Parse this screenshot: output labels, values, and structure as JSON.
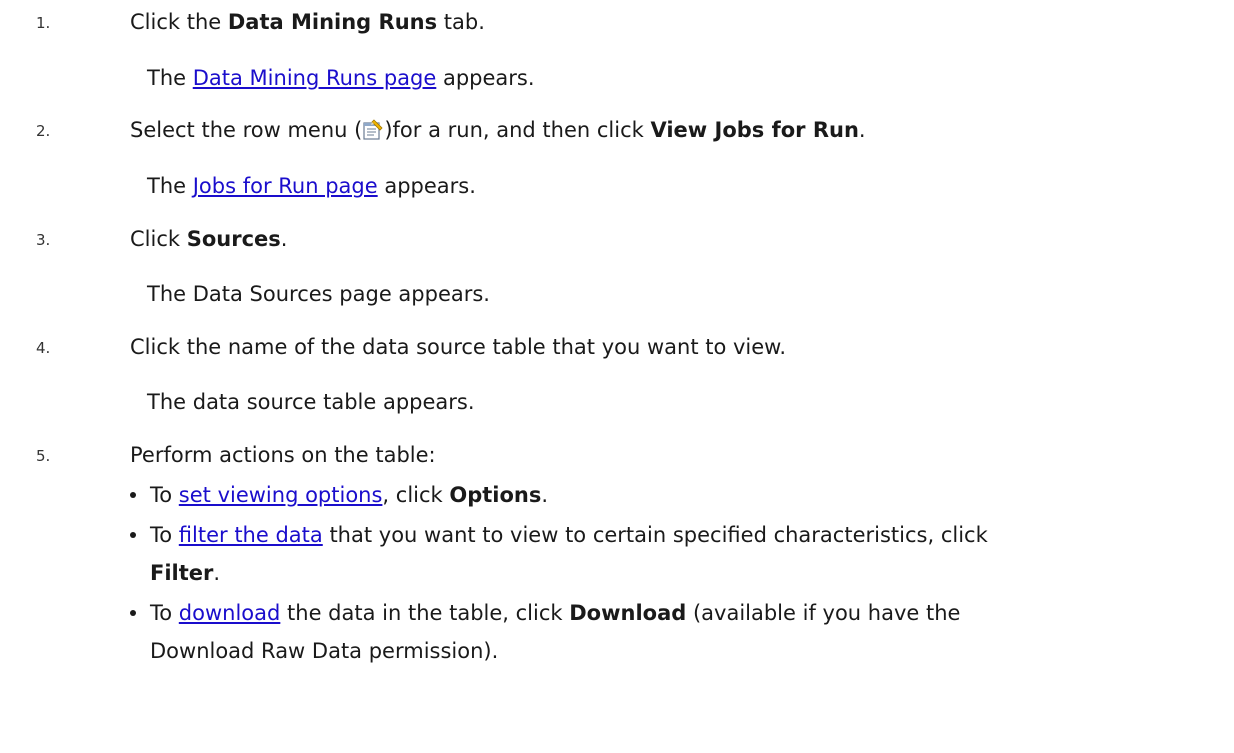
{
  "steps": [
    {
      "num": "1.",
      "pre": "Click the ",
      "bold": "Data Mining Runs",
      "post": " tab.",
      "result": {
        "pre": "The ",
        "link": "Data Mining Runs page",
        "post": " appears."
      }
    },
    {
      "num": "2.",
      "pre": "Select the row menu (",
      "after_icon": ")for a run, and then click ",
      "bold": "View Jobs for Run",
      "post": ".",
      "result": {
        "pre": "The ",
        "link": "Jobs for Run page",
        "post": " appears."
      }
    },
    {
      "num": "3.",
      "pre": "Click ",
      "bold": "Sources",
      "post": ".",
      "result": {
        "text": "The Data Sources page appears."
      }
    },
    {
      "num": "4.",
      "text": "Click the name of the data source table that you want to view.",
      "result": {
        "text": "The data source table appears."
      }
    },
    {
      "num": "5.",
      "text": "Perform actions on the table:",
      "bullets": [
        {
          "pre": "To ",
          "link": "set viewing options",
          "mid": ", click ",
          "bold": "Options",
          "post": "."
        },
        {
          "pre": "To ",
          "link": "filter the data",
          "mid": " that you want to view to certain specified characteristics, click",
          "bold": "Filter",
          "post": "."
        },
        {
          "pre": "To ",
          "link": "download",
          "mid": " the data in the table, click ",
          "bold": "Download",
          "post": " (available if you have the",
          "cont": "Download Raw Data permission)."
        }
      ]
    }
  ],
  "icons": {
    "row_menu": "row-menu-icon"
  },
  "colors": {
    "link": "#1a0dcc",
    "text": "#1a1a1a"
  }
}
